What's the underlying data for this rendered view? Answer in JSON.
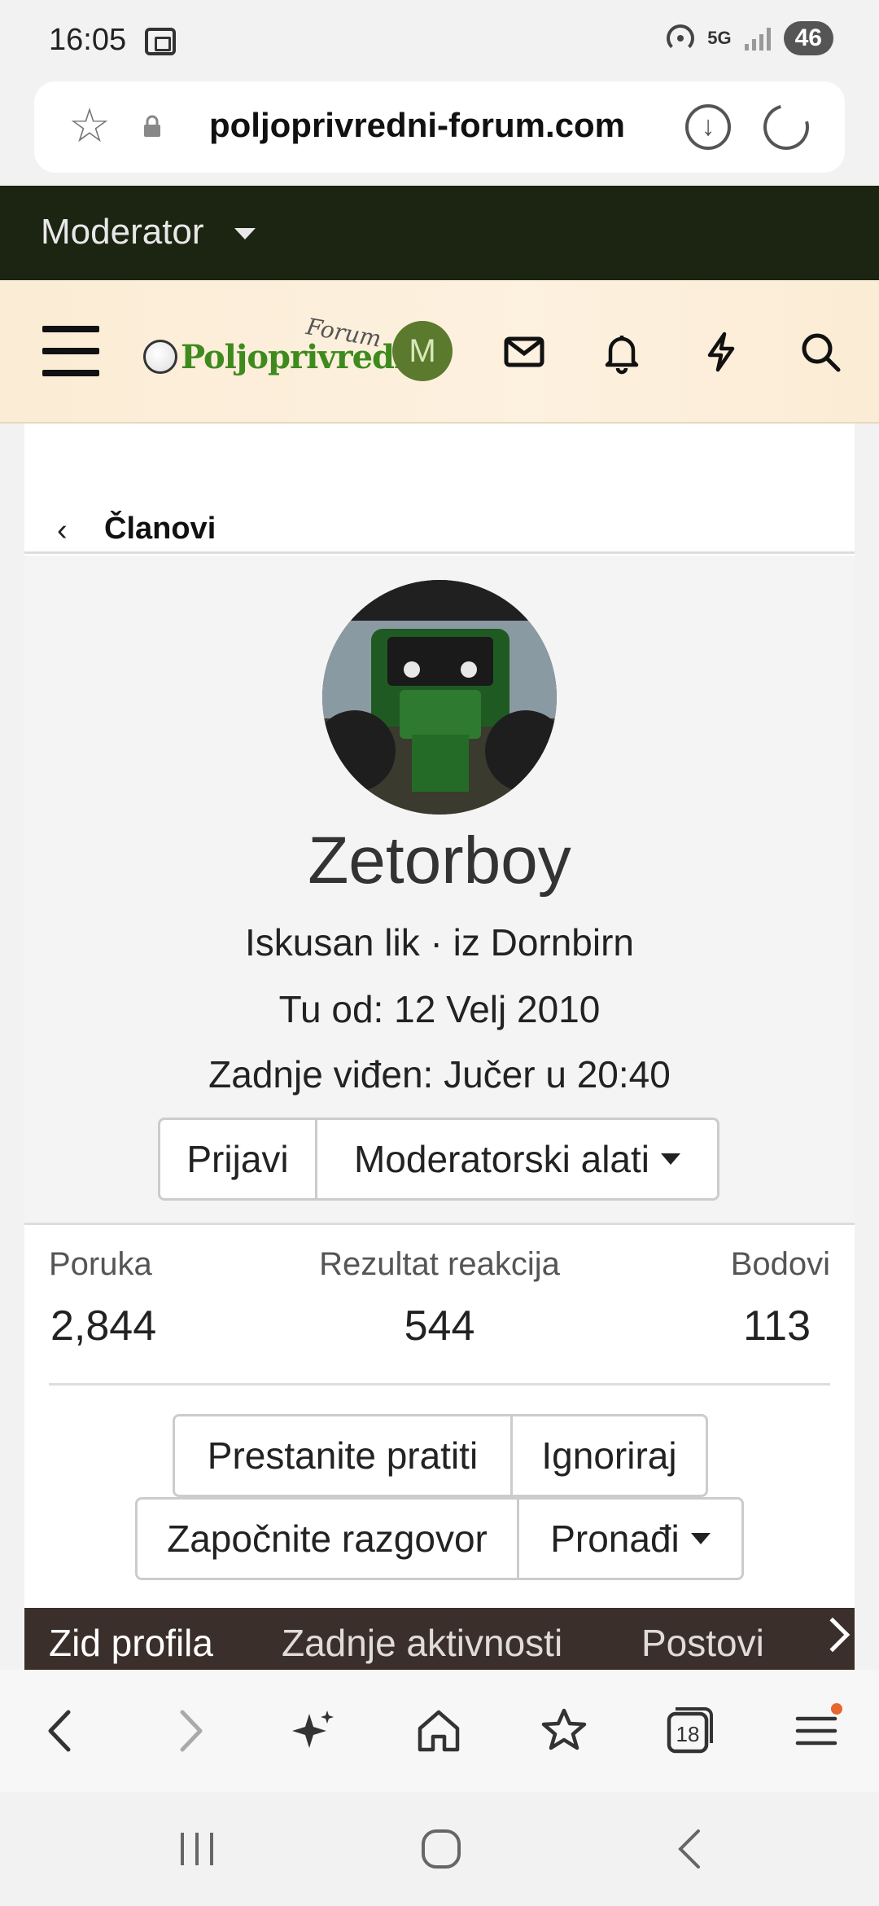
{
  "status_bar": {
    "time": "16:05",
    "network": "5G",
    "battery": "46"
  },
  "browser": {
    "url": "poljoprivredni-forum.com",
    "tabs_count": "18"
  },
  "moderator_bar": {
    "label": "Moderator"
  },
  "header": {
    "logo_text": "Poljoprivredni",
    "logo_script": "Forum",
    "avatar_letter": "M"
  },
  "breadcrumb": {
    "label": "Članovi"
  },
  "profile": {
    "username": "Zetorboy",
    "title_line": "Iskusan lik · iz Dornbirn",
    "joined": "Tu od: 12 Velj 2010",
    "last_seen": "Zadnje viđen: Jučer u 20:40",
    "report_label": "Prijavi",
    "mod_tools_label": "Moderatorski alati"
  },
  "stats": {
    "messages_label": "Poruka",
    "messages_value": "2,844",
    "reactions_label": "Rezultat reakcija",
    "reactions_value": "544",
    "points_label": "Bodovi",
    "points_value": "113"
  },
  "actions": {
    "unfollow": "Prestanite pratiti",
    "ignore": "Ignoriraj",
    "start_conversation": "Započnite razgovor",
    "find": "Pronađi"
  },
  "tabs": [
    "Zid profila",
    "Zadnje aktivnosti",
    "Postovi"
  ],
  "colors": {
    "moderator_bar": "#1c2412",
    "header_bg": "#fbecd5",
    "avatar": "#5b7a2e",
    "tabs_bg": "#3b2f2b",
    "logo_green": "#3e8a1e"
  }
}
